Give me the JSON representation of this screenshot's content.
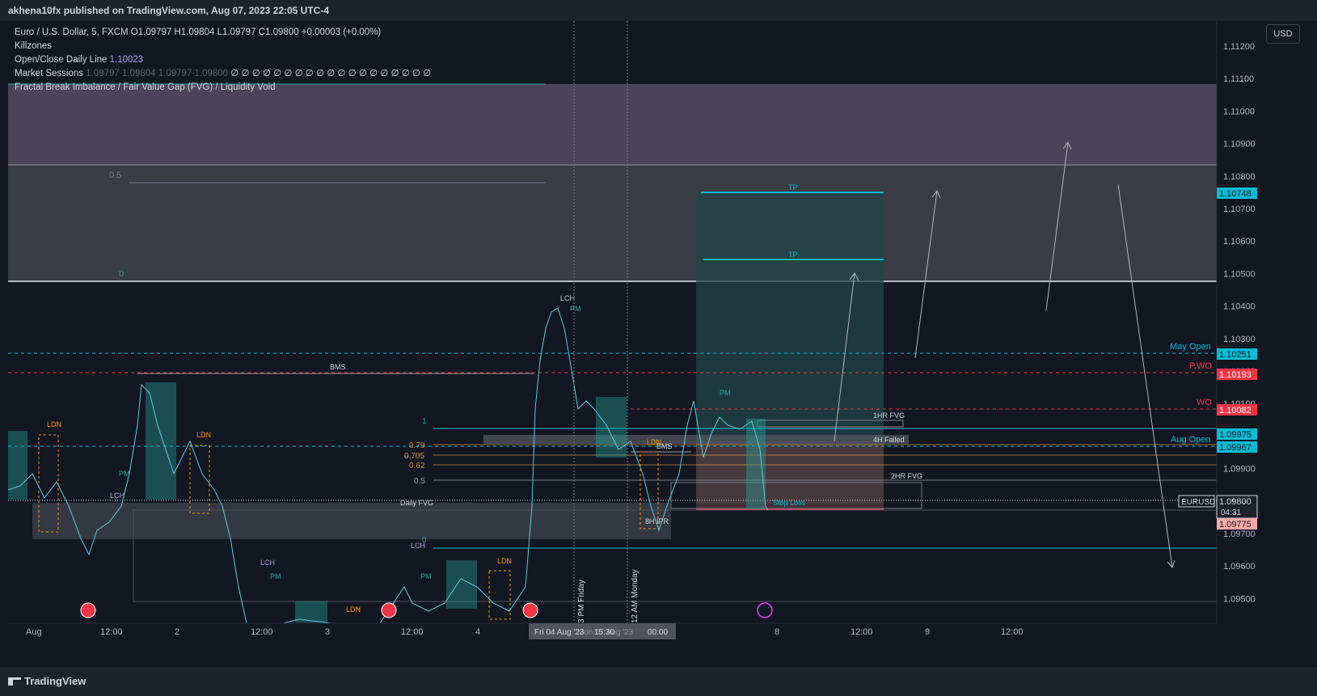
{
  "header": {
    "publisher_line": "akhena10fx published on TradingView.com, Aug 07, 2023 22:05 UTC-4"
  },
  "legend": {
    "symbol_line": "Euro / U.S. Dollar, 5, FXCM  O1.09797  H1.09804  L1.09797  C1.09800  +0.00003 (+0.00%)",
    "killzones": "Killzones",
    "open_close_label": "Open/Close Daily Line",
    "open_close_value": "1.10023",
    "market_sessions_label": "Market Sessions",
    "market_sessions_values": "1.09797  1.09804  1.09797  1.09800",
    "market_sessions_zeros": "∅ ∅ ∅ ∅ ∅ ∅ ∅ ∅ ∅ ∅ ∅ ∅ ∅ ∅ ∅ ∅ ∅ ∅ ∅",
    "fvg_label": "Fractal Break Imbalance / Fair Value Gap (FVG) / Liquidity Void"
  },
  "currency_button": "USD",
  "price_axis": {
    "ticks": [
      "1.11200",
      "1.11100",
      "1.11000",
      "1.10900",
      "1.10800",
      "1.10700",
      "1.10600",
      "1.10500",
      "1.10400",
      "1.10300",
      "1.10200",
      "1.10100",
      "1.10000",
      "1.09900",
      "1.09800",
      "1.09700",
      "1.09600",
      "1.09500"
    ],
    "badges": {
      "tp": "1.10748",
      "may_open": "1.10251",
      "pwo": "1.10193",
      "wo": "1.10082",
      "aug_open_a": "1.09975",
      "aug_open_b": "1.09967",
      "symbol": "EURUSD",
      "last_price": "1.09800",
      "countdown": "04:31",
      "stop": "1.09775"
    },
    "colors": {
      "cyan": "#00bcd4",
      "red": "#f23645",
      "salmon": "#f7a9a8"
    }
  },
  "time_axis": {
    "labels": [
      "Aug",
      "12:00",
      "2",
      "12:00",
      "3",
      "12:00",
      "4",
      "12:00",
      "8",
      "12:00",
      "9",
      "12:00"
    ],
    "crosshair": [
      "Fri 04 Aug '23",
      "15:30",
      "Mon 07 Aug '23",
      "00:00"
    ]
  },
  "level_labels": {
    "may_open": "May Open",
    "pwo": "P.WO",
    "wo": "WO",
    "aug_open": "Aug Open"
  },
  "annotations": {
    "tp": "TP",
    "stop_loss": "Stop Loss",
    "one_hr_fvg": "1HR FVG",
    "four_h_failed": "4H Failed",
    "two_hr_fvg": "2HR FVG",
    "daily_fvg": "Daily FVG",
    "eight_h_ipr": "8H IPR",
    "bms": "BMS",
    "lch": "LCH",
    "pm": "PM",
    "ldn": "LDN",
    "fib_0_5": "0.5",
    "fib_0": "0",
    "fib_1": "1",
    "fib_079": "0.79",
    "fib_0705": "0.705",
    "fib_062": "0.62",
    "three_pm_friday": "3 PM Friday",
    "twelve_am_monday": "12 AM Monday"
  },
  "footer": {
    "brand": "TradingView"
  }
}
